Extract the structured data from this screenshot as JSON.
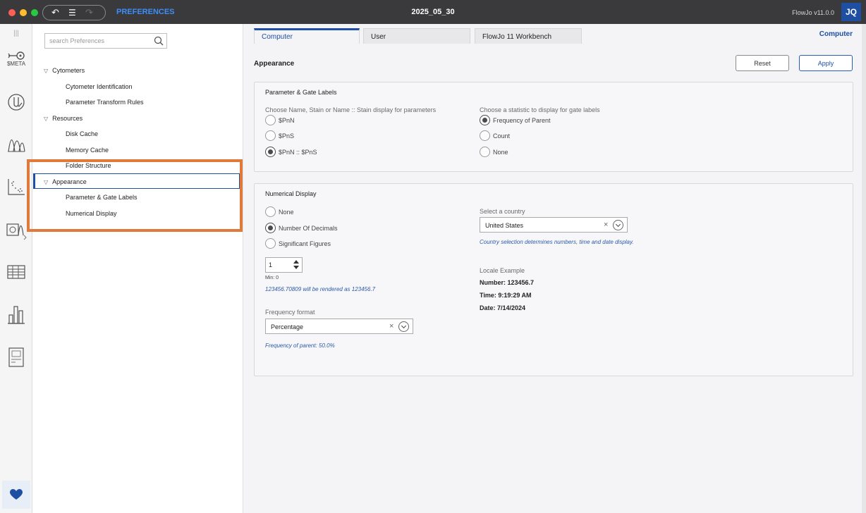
{
  "titlebar": {
    "app_name": "PREFERENCES",
    "file_name": "2025_05_30",
    "version": "FlowJo v11.0.0",
    "user_initials": "JQ"
  },
  "rail": {
    "items": [
      {
        "icon": "meta-key-icon",
        "label": "$META"
      },
      {
        "icon": "test-tube-icon"
      },
      {
        "icon": "histogram-peaks-icon"
      },
      {
        "icon": "scatter-plot-icon"
      },
      {
        "icon": "layout-overlay-icon"
      },
      {
        "icon": "table-icon"
      },
      {
        "icon": "bar-chart-icon"
      },
      {
        "icon": "report-icon"
      },
      {
        "icon": "heart-icon"
      }
    ]
  },
  "search": {
    "placeholder": "search Preferences"
  },
  "tree": {
    "groups": [
      {
        "label": "Cytometers",
        "children": [
          "Cytometer Identification",
          "Parameter Transform Rules"
        ]
      },
      {
        "label": "Resources",
        "children": [
          "Disk Cache",
          "Memory Cache",
          "Folder Structure"
        ]
      },
      {
        "label": "Appearance",
        "children": [
          "Parameter & Gate Labels",
          "Numerical Display"
        ],
        "selected": true
      }
    ]
  },
  "tabs": [
    {
      "label": "Computer",
      "active": true
    },
    {
      "label": "User",
      "active": false
    },
    {
      "label": "FlowJo 11 Workbench",
      "active": false
    }
  ],
  "tab_right_label": "Computer",
  "page": {
    "title": "Appearance",
    "reset_label": "Reset",
    "apply_label": "Apply"
  },
  "param_labels": {
    "title": "Parameter & Gate Labels",
    "name_prompt": "Choose Name, Stain or Name :: Stain display for parameters",
    "name_options": [
      {
        "label": "$PnN",
        "selected": false
      },
      {
        "label": "$PnS",
        "selected": false
      },
      {
        "label": "$PnN :: $PnS",
        "selected": true
      }
    ],
    "stat_prompt": "Choose a statistic to display for gate labels",
    "stat_options": [
      {
        "label": "Frequency of Parent",
        "selected": true
      },
      {
        "label": "Count",
        "selected": false
      },
      {
        "label": "None",
        "selected": false
      }
    ]
  },
  "numerical": {
    "title": "Numerical Display",
    "options": [
      {
        "label": "None",
        "selected": false
      },
      {
        "label": "Number Of Decimals",
        "selected": true
      },
      {
        "label": "Significant Figures",
        "selected": false
      }
    ],
    "decimals_value": "1",
    "min_label": "Min: 0",
    "render_hint": "123456.70809 will be rendered as 123456.7",
    "frequency_format_label": "Frequency format",
    "frequency_format_value": "Percentage",
    "frequency_hint": "Frequency of parent: 50.0%",
    "country_label": "Select a country",
    "country_value": "United States",
    "country_hint": "Country selection determines numbers, time and date display.",
    "locale_title": "Locale Example",
    "locale_number": "Number: 123456.7",
    "locale_time": "Time: 9:19:29 AM",
    "locale_date": "Date: 7/14/2024"
  },
  "colors": {
    "accent": "#1f4fa3",
    "link": "#3d8ef7",
    "highlight": "#e07a3b",
    "titlebar": "#3a3a3c"
  }
}
